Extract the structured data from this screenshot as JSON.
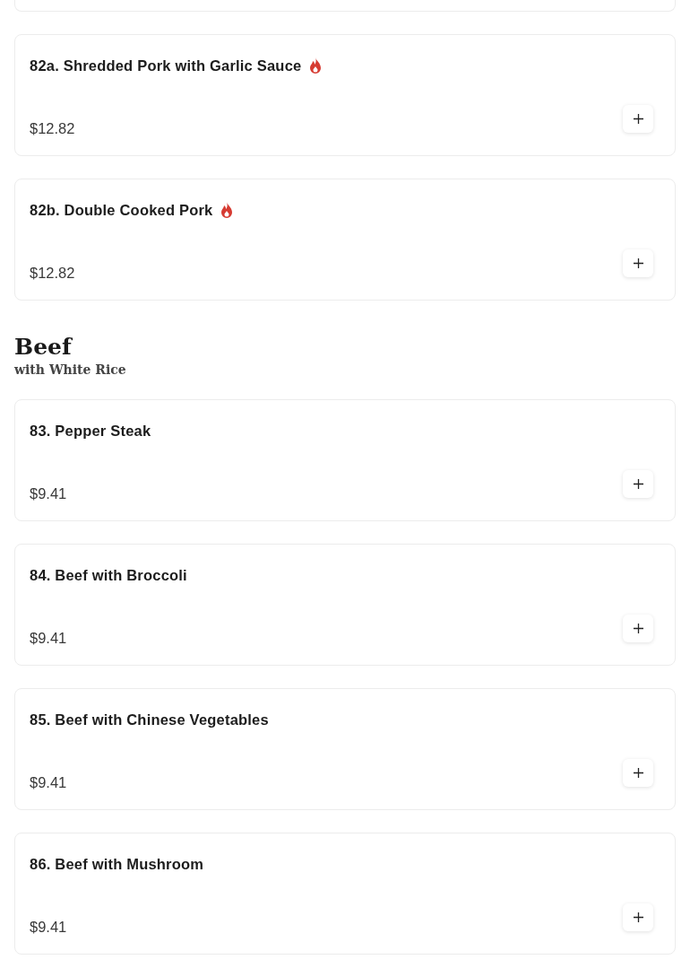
{
  "sections": [
    {
      "items": [
        {
          "name": "82a. Shredded Pork with Garlic Sauce",
          "spicy": true,
          "price": "$12.82"
        },
        {
          "name": "82b. Double Cooked Pork",
          "spicy": true,
          "price": "$12.82"
        }
      ]
    },
    {
      "title": "Beef",
      "subtitle": "with White Rice",
      "items": [
        {
          "name": "83. Pepper Steak",
          "spicy": false,
          "price": "$9.41"
        },
        {
          "name": "84. Beef with Broccoli",
          "spicy": false,
          "price": "$9.41"
        },
        {
          "name": "85. Beef with Chinese Vegetables",
          "spicy": false,
          "price": "$9.41"
        },
        {
          "name": "86. Beef with Mushroom",
          "spicy": false,
          "price": "$9.41"
        }
      ]
    }
  ]
}
